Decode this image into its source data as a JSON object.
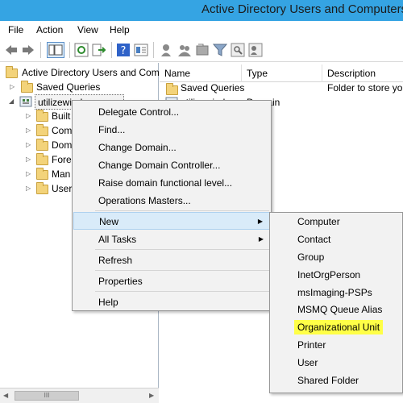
{
  "window": {
    "title": "Active Directory Users and Computers"
  },
  "menu": [
    "File",
    "Action",
    "View",
    "Help"
  ],
  "tree": {
    "root": "Active Directory Users and Com",
    "saved_queries": "Saved Queries",
    "domain": "utilizewindows.com",
    "children": [
      "Built",
      "Com",
      "Dom",
      "Fore",
      "Man",
      "User"
    ]
  },
  "list": {
    "columns": [
      "Name",
      "Type",
      "Description"
    ],
    "rows": [
      {
        "name": "Saved Queries",
        "type": "",
        "description": "Folder to store you"
      },
      {
        "name": "utilizewindows",
        "type": "Domain",
        "description": ""
      }
    ]
  },
  "context_menu": {
    "items": [
      "Delegate Control...",
      "Find...",
      "Change Domain...",
      "Change Domain Controller...",
      "Raise domain functional level...",
      "Operations Masters...",
      "New",
      "All Tasks",
      "Refresh",
      "Properties",
      "Help"
    ]
  },
  "submenu": {
    "items": [
      "Computer",
      "Contact",
      "Group",
      "InetOrgPerson",
      "msImaging-PSPs",
      "MSMQ Queue Alias",
      "Organizational Unit",
      "Printer",
      "User",
      "Shared Folder"
    ],
    "highlight_color": "#ffff47"
  },
  "colors": {
    "titlebar": "#35a4e3",
    "menu_highlight": "#d9ebf9"
  },
  "scrollbar": {
    "grip": "III"
  }
}
